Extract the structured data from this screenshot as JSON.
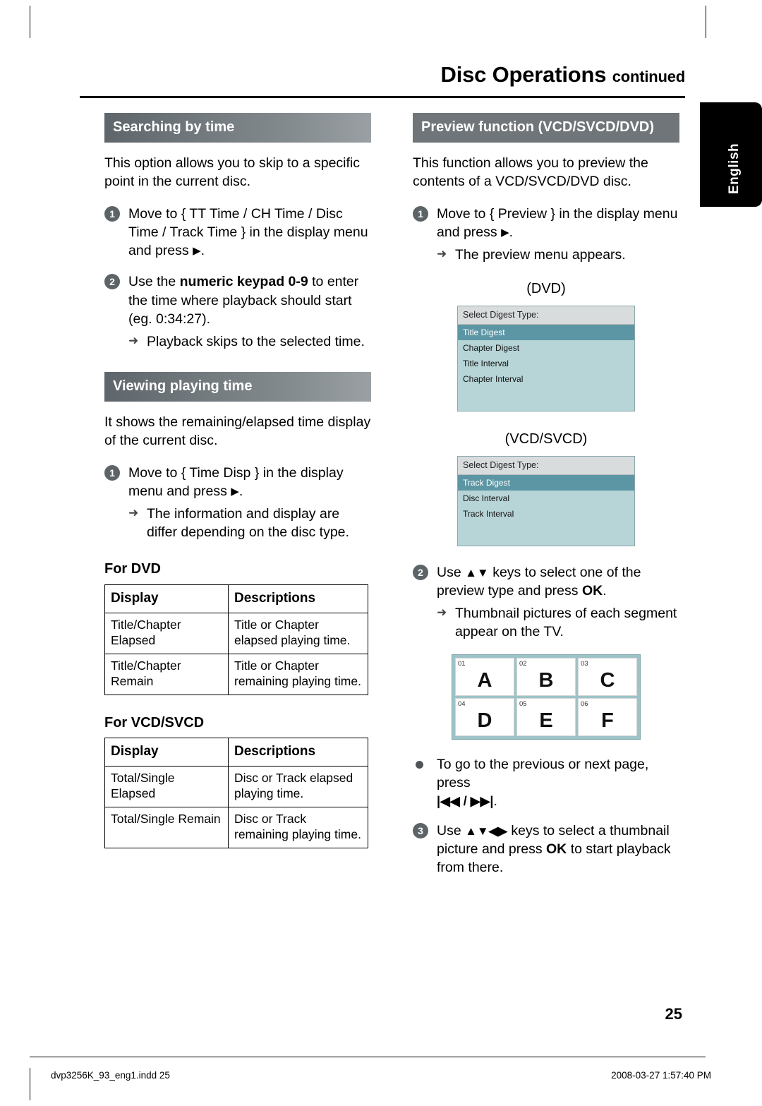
{
  "header": {
    "title": "Disc Operations",
    "continued": "continued",
    "side_tab": "English"
  },
  "left_column": {
    "section1": {
      "heading": "Searching by time",
      "intro": "This option allows you to skip to a specific point in the current disc.",
      "step1_pre": "Move to { TT Time / CH Time / Disc Time / Track Time } in the display menu and press",
      "step1_post": ".",
      "step2_a": "Use the ",
      "step2_b": "numeric keypad 0-9",
      "step2_c": " to enter the time where playback should start (eg. 0:34:27).",
      "step2_sub": "Playback skips to the selected time."
    },
    "section2": {
      "heading": "Viewing playing time",
      "intro": "It shows the remaining/elapsed time display of the current disc.",
      "step1_pre": "Move to { Time Disp } in the display menu and press",
      "step1_post": ".",
      "step1_sub": "The information and display are differ depending on the disc type."
    },
    "dvd_table": {
      "title": "For DVD",
      "headers": [
        "Display",
        "Descriptions"
      ],
      "rows": [
        [
          "Title/Chapter Elapsed",
          "Title or Chapter elapsed playing time."
        ],
        [
          "Title/Chapter Remain",
          "Title or Chapter remaining playing time."
        ]
      ]
    },
    "vcd_table": {
      "title": "For VCD/SVCD",
      "headers": [
        "Display",
        "Descriptions"
      ],
      "rows": [
        [
          "Total/Single Elapsed",
          "Disc or Track elapsed playing time."
        ],
        [
          "Total/Single Remain",
          "Disc or Track remaining playing time."
        ]
      ]
    }
  },
  "right_column": {
    "heading": "Preview function (VCD/SVCD/DVD)",
    "intro": "This function allows you to preview the contents of a VCD/SVCD/DVD disc.",
    "step1_pre": "Move to { Preview } in the display menu and press",
    "step1_post": ".",
    "step1_sub": "The preview menu appears.",
    "dvd_caption": "(DVD)",
    "dvd_osd": {
      "header": "Select Digest Type:",
      "items": [
        "Title  Digest",
        "Chapter  Digest",
        "Title Interval",
        "Chapter Interval"
      ],
      "selected_index": 0
    },
    "vcd_caption": "(VCD/SVCD)",
    "vcd_osd": {
      "header": "Select Digest Type:",
      "items": [
        "Track  Digest",
        "Disc Interval",
        "Track Interval"
      ],
      "selected_index": 0
    },
    "step2_a": "Use",
    "step2_keys": "▲▼",
    "step2_b": "keys to select one of the preview type and press",
    "step2_ok": "OK",
    "step2_end": ".",
    "step2_sub": "Thumbnail pictures of each segment appear on the TV.",
    "thumbnails": [
      {
        "index": "01",
        "letter": "A"
      },
      {
        "index": "02",
        "letter": "B"
      },
      {
        "index": "03",
        "letter": "C"
      },
      {
        "index": "04",
        "letter": "D"
      },
      {
        "index": "05",
        "letter": "E"
      },
      {
        "index": "06",
        "letter": "F"
      }
    ],
    "bullet_text": "To go to the previous or next page, press",
    "bullet_keys": "|◀◀ / ▶▶|",
    "bullet_end": ".",
    "step3_a": "Use",
    "step3_keys": "▲▼◀▶",
    "step3_b": "keys to select a thumbnail picture and press",
    "step3_ok": "OK",
    "step3_c": "to start playback from there."
  },
  "footer": {
    "page_number": "25",
    "file": "dvp3256K_93_eng1.indd   25",
    "timestamp": "2008-03-27   1:57:40 PM"
  }
}
